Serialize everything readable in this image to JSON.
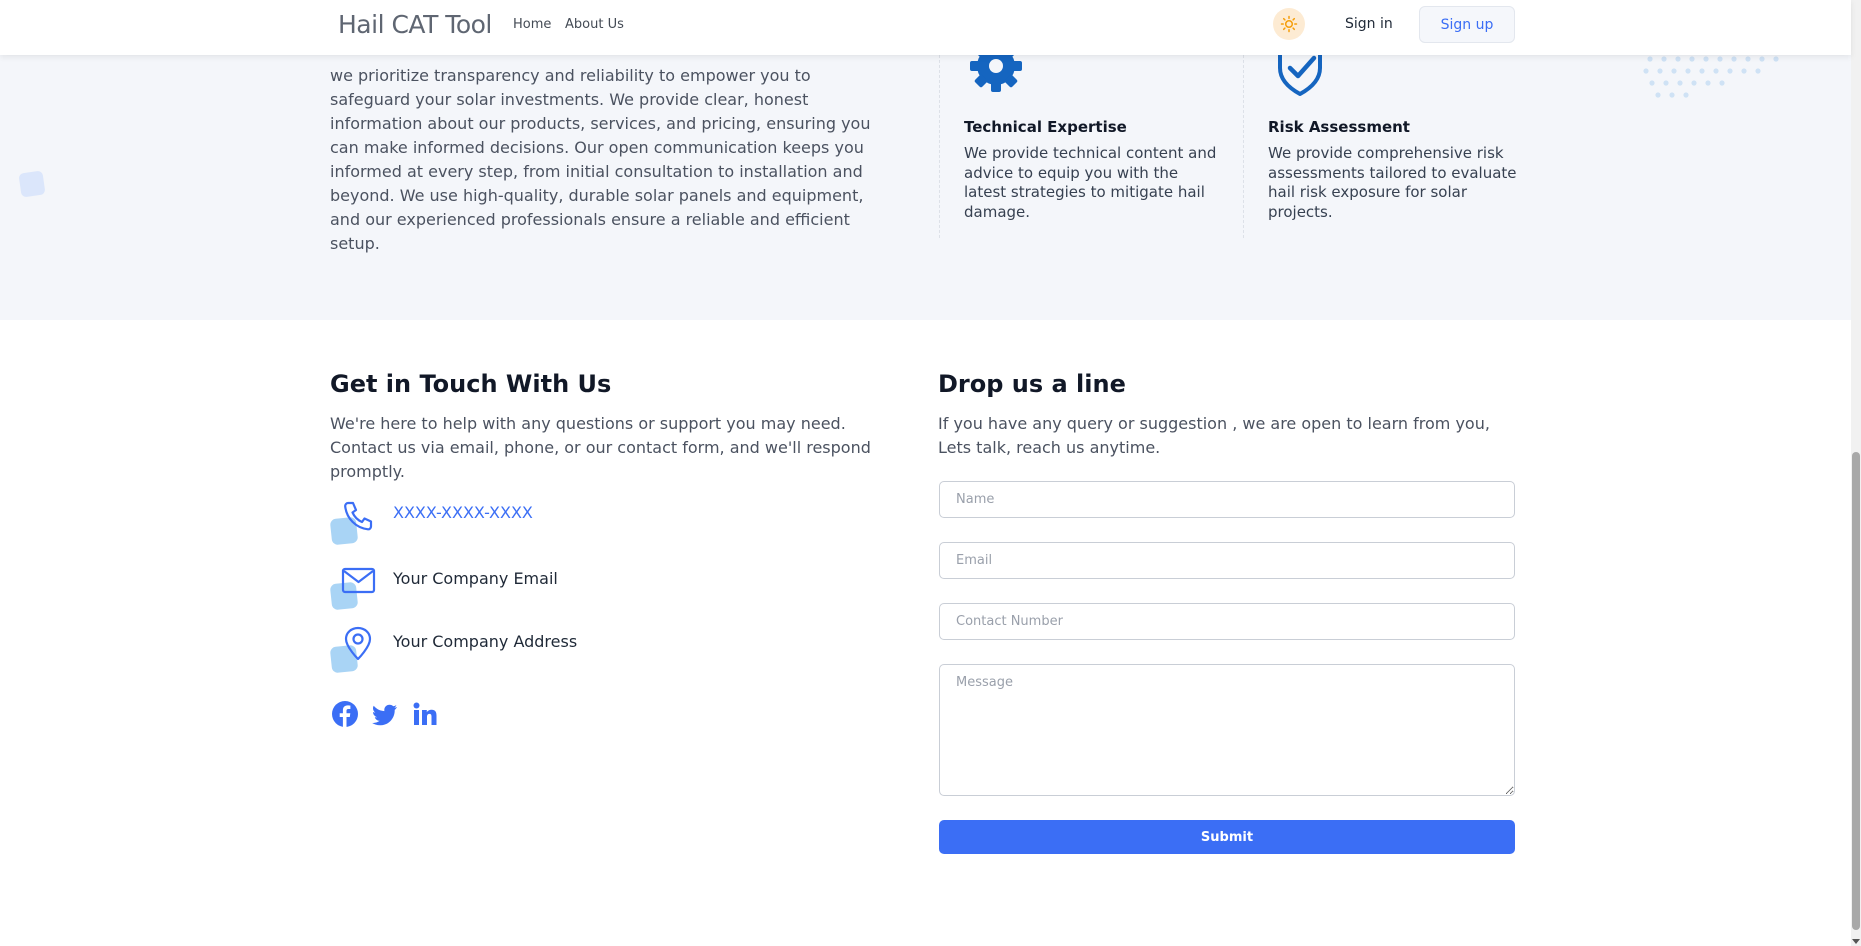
{
  "header": {
    "brand": "Hail CAT Tool",
    "nav": [
      "Home",
      "About Us"
    ],
    "theme_icon": "sun-icon",
    "signin": "Sign in",
    "signup": "Sign up"
  },
  "about": {
    "text": "we prioritize transparency and reliability to empower you to safeguard your solar investments. We provide clear, honest information about our products, services, and pricing, ensuring you can make informed decisions. Our open communication keeps you informed at every step, from initial consultation to installation and beyond. We use high-quality, durable solar panels and equipment, and our experienced professionals ensure a reliable and efficient setup.",
    "features": [
      {
        "icon": "gear-icon",
        "title": "Technical Expertise",
        "desc": "We provide technical content and advice to equip you with the latest strategies to mitigate hail damage."
      },
      {
        "icon": "shield-check-icon",
        "title": "Risk Assessment",
        "desc": "We provide comprehensive risk assessments tailored to evaluate hail risk exposure for solar projects."
      }
    ]
  },
  "contact": {
    "title": "Get in Touch With Us",
    "desc": "We're here to help with any questions or support you may need. Contact us via email, phone, or our contact form, and we'll respond promptly.",
    "phone": "XXXX-XXXX-XXXX",
    "email": "Your Company Email",
    "address": "Your Company Address",
    "socials": [
      "facebook-icon",
      "twitter-icon",
      "linkedin-icon"
    ]
  },
  "form": {
    "title": "Drop us a line",
    "desc": "If you have any query or suggestion , we are open to learn from you, Lets talk, reach us anytime.",
    "name_placeholder": "Name",
    "email_placeholder": "Email",
    "phone_placeholder": "Contact Number",
    "message_placeholder": "Message",
    "submit": "Submit"
  },
  "colors": {
    "accent": "#3b6ef5",
    "icon_blue": "#1565c0",
    "section_bg": "#f4f6fa"
  }
}
